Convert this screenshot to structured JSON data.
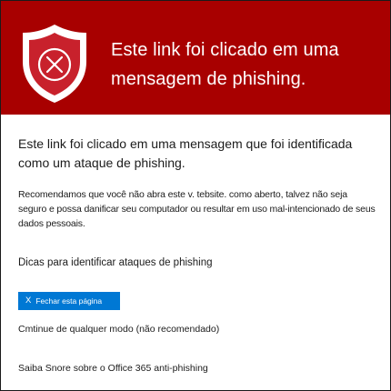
{
  "banner": {
    "title": "Este link foi clicado em uma mensagem de phishing.",
    "background_color": "#a80000",
    "icon": "shield-x-icon"
  },
  "body": {
    "lead": "Este link foi clicado em uma mensagem que foi identificada como um ataque de phishing.",
    "detail": "Recomendamos que você não abra este v. tebsite. como aberto, talvez não seja seguro e possa danificar seu computador ou resultar em uso mal-intencionado de seus dados pessoais."
  },
  "links": {
    "tips": "Dicas para identificar ataques de phishing",
    "continue": "Cmtinue de qualquer modo (não recomendado)",
    "learn_more": "Saiba Snore sobre o Office 365 anti-phishing"
  },
  "close_button": {
    "icon": "X",
    "label": "Fechar esta página",
    "color": "#0078d4"
  }
}
